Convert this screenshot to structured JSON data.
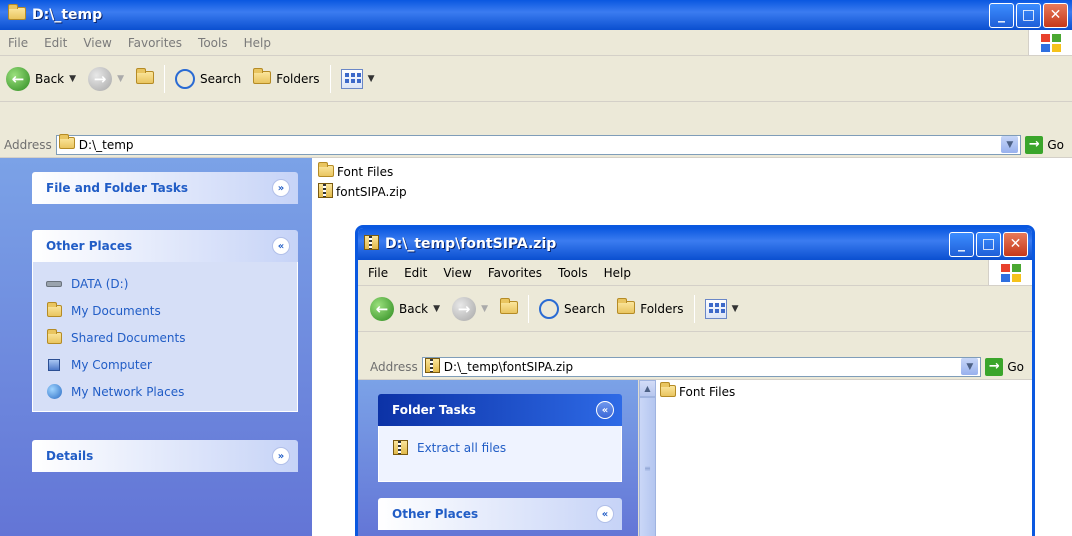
{
  "back_window": {
    "title": "D:\\_temp",
    "menu": [
      "File",
      "Edit",
      "View",
      "Favorites",
      "Tools",
      "Help"
    ],
    "toolbar": {
      "back": "Back",
      "search": "Search",
      "folders": "Folders"
    },
    "address": {
      "label": "Address",
      "value": "D:\\_temp",
      "go": "Go"
    },
    "panels": {
      "file_folder_tasks": "File and Folder Tasks",
      "other_places": {
        "title": "Other Places",
        "items": [
          "DATA (D:)",
          "My Documents",
          "Shared Documents",
          "My Computer",
          "My Network Places"
        ]
      },
      "details": "Details"
    },
    "files": [
      "Font Files",
      "fontSIPA.zip"
    ]
  },
  "front_window": {
    "title": "D:\\_temp\\fontSIPA.zip",
    "menu": [
      "File",
      "Edit",
      "View",
      "Favorites",
      "Tools",
      "Help"
    ],
    "toolbar": {
      "back": "Back",
      "search": "Search",
      "folders": "Folders"
    },
    "address": {
      "label": "Address",
      "value": "D:\\_temp\\fontSIPA.zip",
      "go": "Go"
    },
    "panels": {
      "folder_tasks": {
        "title": "Folder Tasks",
        "items": [
          "Extract all files"
        ]
      },
      "other_places": "Other Places"
    },
    "files": [
      "Font Files"
    ]
  },
  "colors": {
    "titlebar": "#0a58e0",
    "taskpane": "#6f8fe0",
    "chrome": "#ece9d8"
  }
}
